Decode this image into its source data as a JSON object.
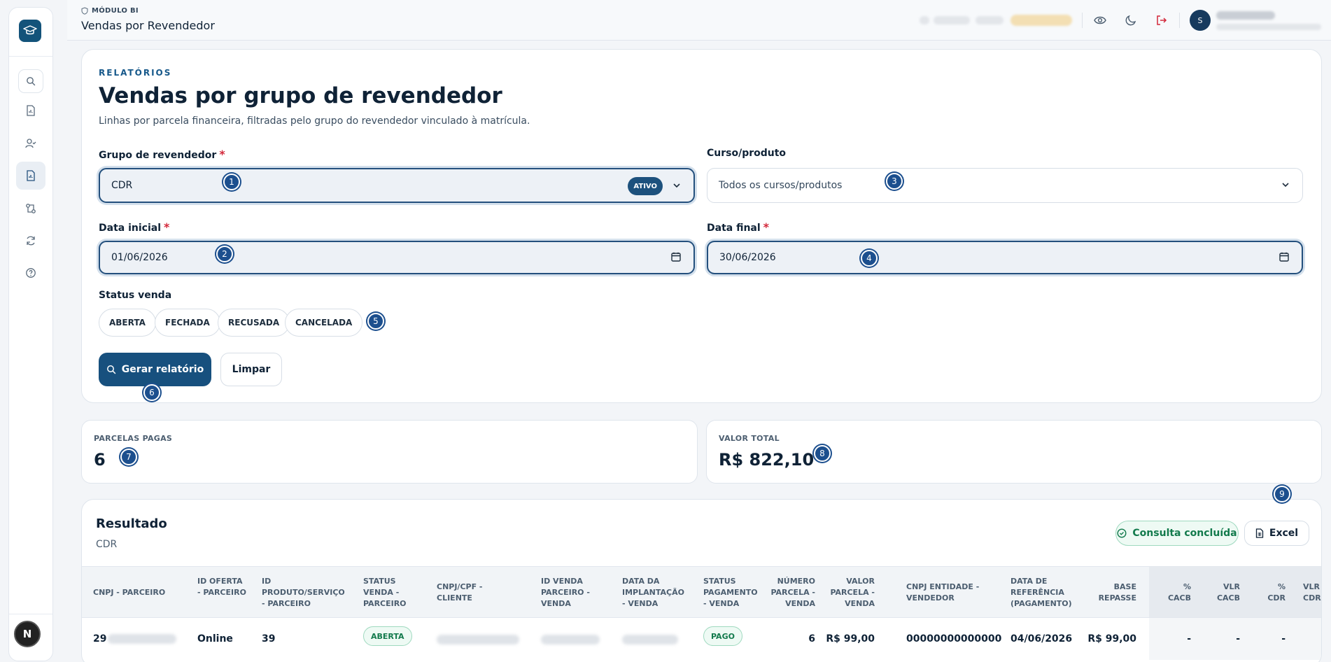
{
  "header": {
    "breadcrumb": "MÓDULO BI",
    "title": "Vendas por Revendedor",
    "user_initial": "S"
  },
  "sidebar": {
    "bottom_avatar": "N",
    "items": [
      "search-icon",
      "report-icon",
      "user-check-icon",
      "report-active-icon",
      "transfer-icon",
      "refresh-icon",
      "help-icon"
    ]
  },
  "filters": {
    "eyebrow": "RELATÓRIOS",
    "heading": "Vendas por grupo de revendedor",
    "subtitle": "Linhas por parcela financeira, filtradas pelo grupo do revendedor vinculado à matrícula.",
    "grupo_label": "Grupo de revendedor",
    "grupo_value": "CDR",
    "grupo_badge": "ATIVO",
    "curso_label": "Curso/produto",
    "curso_value": "Todos os cursos/produtos",
    "data_inicial_label": "Data inicial",
    "data_inicial_value": "01/06/2026",
    "data_final_label": "Data final",
    "data_final_value": "30/06/2026",
    "required_mark": "*",
    "status_label": "Status venda",
    "status_options": [
      "ABERTA",
      "FECHADA",
      "RECUSADA",
      "CANCELADA"
    ],
    "generate_label": "Gerar relatório",
    "clear_label": "Limpar"
  },
  "stats": {
    "parcelas_label": "PARCELAS PAGAS",
    "parcelas_value": "6",
    "valor_label": "VALOR TOTAL",
    "valor_value": "R$ 822,10"
  },
  "result": {
    "title": "Resultado",
    "subtitle": "CDR",
    "status_pill": "Consulta concluída",
    "excel_label": "Excel",
    "columns": [
      "CNPJ - PARCEIRO",
      "ID OFERTA - PARCEIRO",
      "ID PRODUTO/SERVIÇO - PARCEIRO",
      "STATUS VENDA - PARCEIRO",
      "CNPJ/CPF - CLIENTE",
      "ID VENDA PARCEIRO - VENDA",
      "DATA DA IMPLANTAÇÃO - VENDA",
      "STATUS PAGAMENTO - VENDA",
      "NÚMERO PARCELA - VENDA",
      "VALOR PARCELA - VENDA",
      "CNPJ ENTIDADE - VENDEDOR",
      "DATA DE REFERÊNCIA (PAGAMENTO)",
      "BASE REPASSE",
      "% CACB",
      "VLR CACB",
      "% CDR",
      "VLR CDR"
    ],
    "row": {
      "cnpj_parceiro_prefix": "29",
      "id_oferta": "Online",
      "id_produto": "39",
      "status_venda": "ABERTA",
      "status_pagamento": "PAGO",
      "numero_parcela": "6",
      "valor_parcela": "R$ 99,00",
      "cnpj_entidade": "00000000000000",
      "data_referencia": "04/06/2026",
      "base_repasse": "R$ 99,00",
      "pct_cacb": "-",
      "vlr_cacb": "-",
      "pct_cdr": "-"
    }
  },
  "markers": [
    "1",
    "2",
    "3",
    "4",
    "5",
    "6",
    "7",
    "8",
    "9"
  ]
}
